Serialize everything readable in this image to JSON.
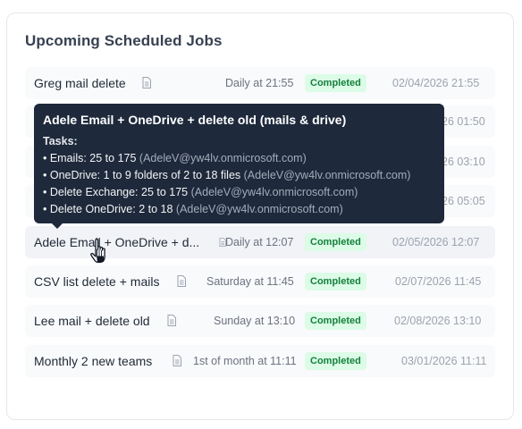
{
  "panel": {
    "title": "Upcoming Scheduled Jobs"
  },
  "jobs": [
    {
      "name": "Greg mail delete",
      "schedule": "Daily at 21:55",
      "status": "Completed",
      "timestamp": "02/04/2026 21:55"
    },
    {
      "name": "",
      "schedule": "",
      "status": "",
      "timestamp": "26 01:50"
    },
    {
      "name": "",
      "schedule": "",
      "status": "",
      "timestamp": "26 03:10"
    },
    {
      "name": "",
      "schedule": "",
      "status": "",
      "timestamp": "26 05:05"
    },
    {
      "name": "Adele Email + OneDrive + d...",
      "schedule": "Daily at 12:07",
      "status": "Completed",
      "timestamp": "02/05/2026 12:07"
    },
    {
      "name": "CSV list delete + mails",
      "schedule": "Saturday at 11:45",
      "status": "Completed",
      "timestamp": "02/07/2026 11:45"
    },
    {
      "name": "Lee mail + delete old",
      "schedule": "Sunday at 13:10",
      "status": "Completed",
      "timestamp": "02/08/2026 13:10"
    },
    {
      "name": "Monthly 2 new teams",
      "schedule": "1st of month at 11:11",
      "status": "Completed",
      "timestamp": "03/01/2026 11:11"
    }
  ],
  "tooltip": {
    "title": "Adele Email + OneDrive + delete old (mails & drive)",
    "tasks_heading": "Tasks:",
    "tasks": [
      {
        "text": "• Emails: 25 to 175",
        "account": "(AdeleV@yw4lv.onmicrosoft.com)"
      },
      {
        "text": "• OneDrive: 1 to 9 folders of 2 to 18 files",
        "account": "(AdeleV@yw4lv.onmicrosoft.com)"
      },
      {
        "text": "• Delete Exchange: 25 to 175",
        "account": "(AdeleV@yw4lv.onmicrosoft.com)"
      },
      {
        "text": "• Delete OneDrive: 2 to 18",
        "account": "(AdeleV@yw4lv.onmicrosoft.com)"
      }
    ]
  },
  "colors": {
    "badge_bg": "#dcfce7",
    "badge_text": "#15803d",
    "tooltip_bg": "#1e293b"
  },
  "icons": {
    "row_icon": "document-icon",
    "cursor": "hand-pointer-icon"
  }
}
